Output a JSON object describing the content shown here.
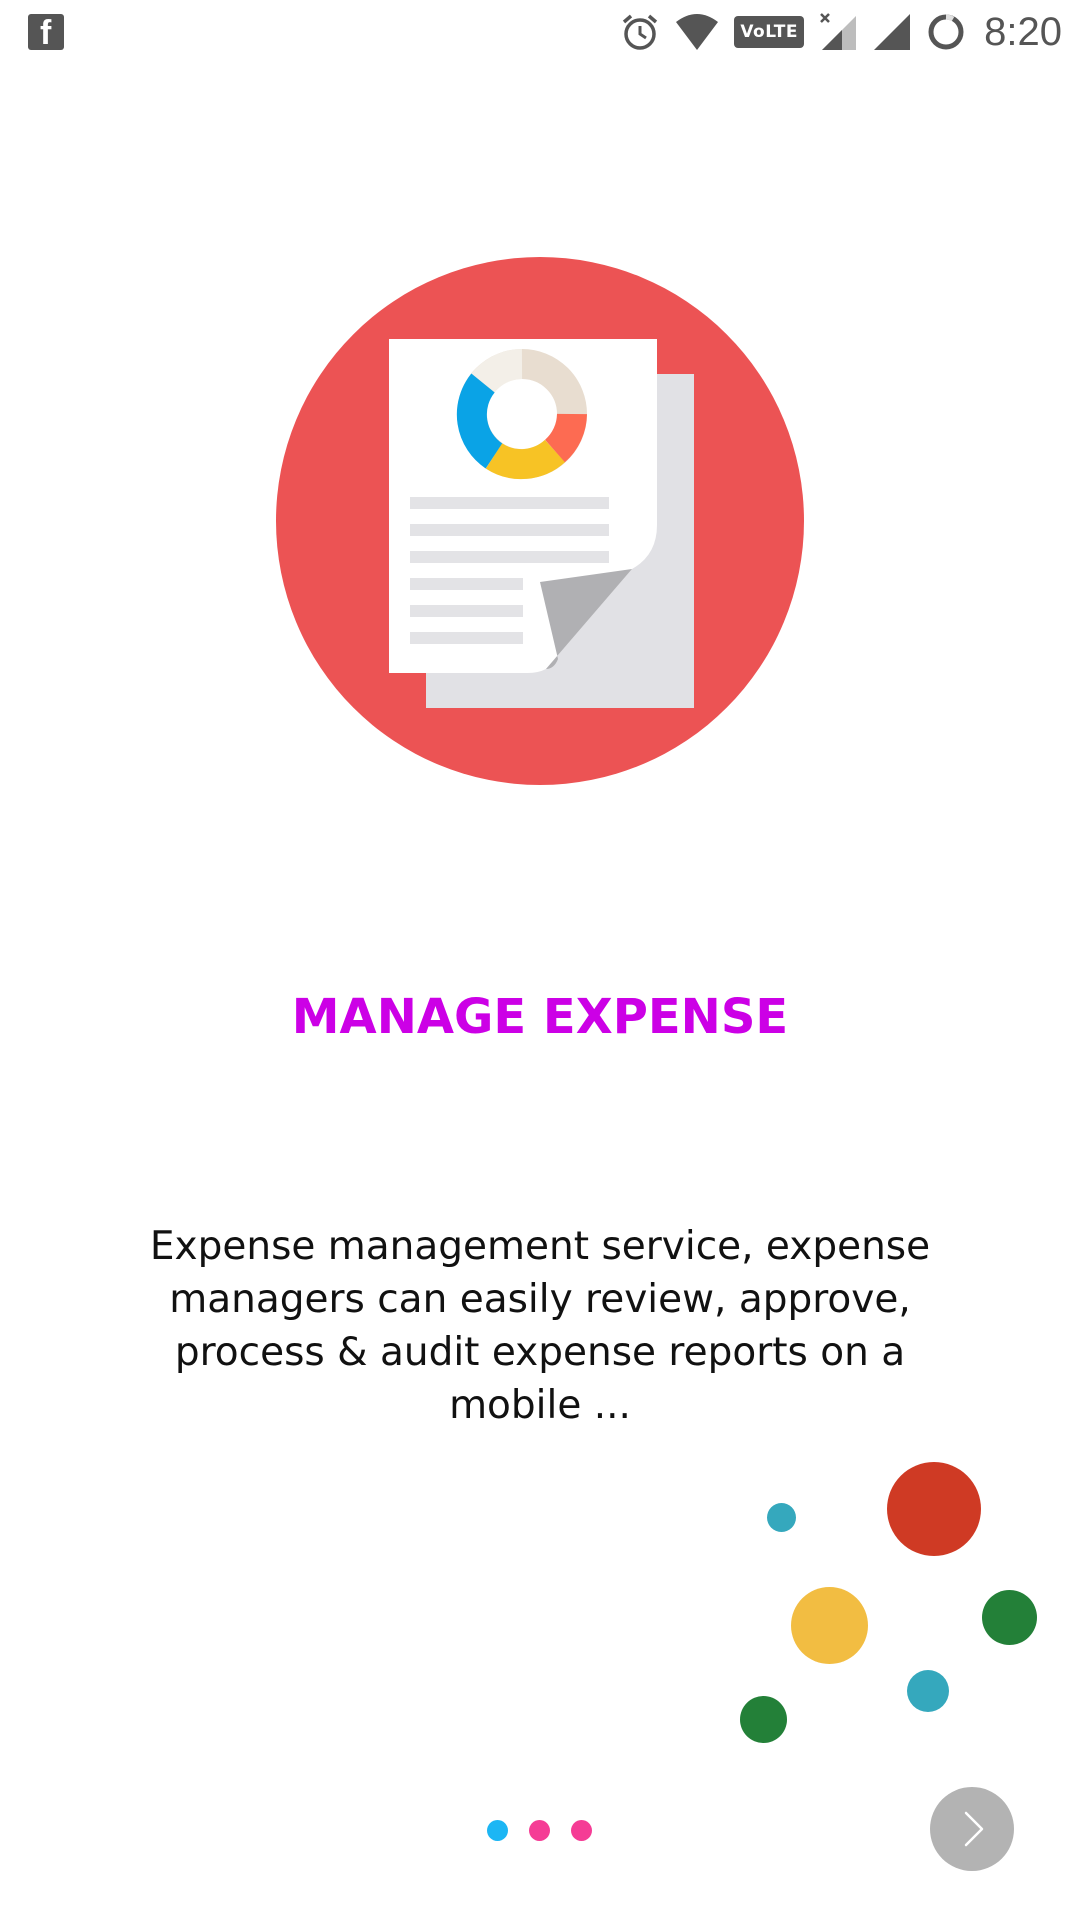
{
  "status_bar": {
    "time": "8:20",
    "volte_label": "VoLTE",
    "icons": [
      "facebook-icon",
      "alarm-icon",
      "wifi-icon",
      "volte-icon",
      "signal-no-data-icon",
      "signal-icon",
      "battery-ring-icon"
    ]
  },
  "hero": {
    "icon": "expense-report-document-icon",
    "circle_color": "#ec5354",
    "donut_colors": [
      "#0aa3e6",
      "#f7c325",
      "#fd6b52",
      "#e8ddd0"
    ]
  },
  "intro": {
    "title": "MANAGE EXPENSE",
    "title_color": "#cc00e6",
    "description": "Expense management service, expense managers can easily review, approve, process & audit expense reports on a mobile ..."
  },
  "decor_colors": {
    "red": "#cf3a24",
    "teal": "#35a8bd",
    "yellow": "#f2bd42",
    "green": "#238038"
  },
  "pager": {
    "pages": 3,
    "current": 1,
    "active_color": "#1cb6f4",
    "inactive_color": "#f53c95"
  },
  "next_button": {
    "icon": "chevron-right-icon",
    "color": "#b3b3b3"
  }
}
